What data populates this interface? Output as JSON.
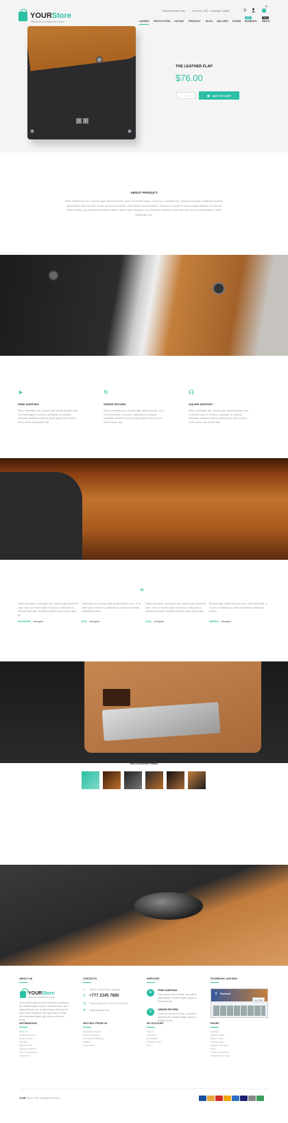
{
  "header": {
    "logo_main": "YOUR",
    "logo_accent": "Store",
    "logo_tagline": "PREMIUM ECOMMERCE THEME",
    "welcome": "Default welcome msg",
    "currency": "Currency: USD",
    "language": "Language: English",
    "cart_count": "0",
    "nav": [
      "LAYOUT",
      "PROTOTYPES",
      "LISTING",
      "PRODUCT",
      "BLOG",
      "GALLERY",
      "PAGES",
      "WOMEN'S",
      "MEN'S"
    ],
    "badges": {
      "womens": "NEW",
      "mens": "SALE"
    }
  },
  "product": {
    "title": "THE LEATHER FLAP",
    "price": "$76.00",
    "qty": "1",
    "minus": "–",
    "plus": "+",
    "add_to_cart": "ADD TO CART",
    "prev": "‹",
    "next": "›"
  },
  "about": {
    "title": "ABOUT PRODUCT",
    "text": "Tellus, scelerisque nec, rhoncus eget, laoreet sit amet, nunc. Ut sit amet turpis. In est arcu, sollicitudin eu, vehicula venenatis, vestibulum pretium, ipsum ipsum dolor sit amet. Donec rutrum arcu laoreet, velit tincidunt euismod libero. Tincidunt ut laoreet et dolore magna aliquam. Ut enim ad minim veniam, quis nostrud exercitation ullamco laboris nisi ut aliquip ex ea commodo consequat. Duis aute irure dolor in reprehenderit. Tellus, scelerisque nec."
  },
  "features": [
    {
      "icon": "➤",
      "title": "FREE SHIPPING",
      "text": "Tellus, scelerisque nec, rhoncus eget, laoreet sit amet, nunc. Ut sit amet turpis. In est arcu, sollicitudin eu, vehicula venenatis, vestibulum pretium, ipsum ipsum dolor sit amet. Donec rutrum arcu laoreet velit."
    },
    {
      "icon": "↻",
      "title": "ORDER RETURN",
      "text": "Tellus, scelerisque nec, rhoncus eget, laoreet sit amet, nunc. Ut sit amet turpis. In est arcu, sollicitudin eu, vehicula venenatis, vestibulum pretium, ipsum ipsum dolor sit amet. Donec rutrum arcu."
    },
    {
      "icon": "☊",
      "title": "ONLINE SUPPORT",
      "text": "Tellus, scelerisque nec, rhoncus eget, laoreet sit amet, nunc. Ut sit amet turpis. In est arcu, sollicitudin eu, vehicula venenatis, vestibulum pretium, ipsum ipsum dolor sit amet. Donec rutrum arcu laoreet velit."
    }
  ],
  "testimonials": {
    "quote": "“",
    "items": [
      {
        "text": "Ornare arcu tellus, scelerisque nec, rhoncus eget, laoreet sit amet, nunc. Ut sit amet turpis. In est arcu, sollicitudin eu, vehicula venenatis, vestibulum pretium, ipsum ipsum dolor sit.",
        "name": "ELEANOR",
        "role": "designer"
      },
      {
        "text": "Scelerisque nec, rhoncus eget laoreet sit amet, nunc. Ut sit amet turpis. In est arcu, sollicitudin eu, vehicula venenatis, vestibulum pretium.",
        "name": "EVA",
        "role": "designer"
      },
      {
        "text": "Ornare arcu tellus, scelerisque nec, rhoncus eget, laoreet sit amet, nunc. Ut sit amet turpis. In est arcu, sollicitudin eu, vehicula venenatis, vestibulum pretium, ipsum ipsum dolor.",
        "name": "LISA",
        "role": "designer"
      },
      {
        "text": "Rhoncus eget, laoreet sit amet, nunc. Ut sit amet turpis. In est arcu, sollicitudin eu, vehicula venenatis, vestibulum pretium.",
        "name": "SARAH",
        "role": "designer"
      }
    ]
  },
  "instagram": {
    "title": "INSTAGRAM FEED"
  },
  "footer": {
    "about": {
      "title": "ABOUT US",
      "logo_main": "YOUR",
      "logo_accent": "Store",
      "logo_tagline": "PREMIUM ECOMMERCE THEME",
      "text": "Lorem ipsum dolor sit amet, consectetur adipiscing elit. Nullam fringilla, augue ut tincidunt luctus, arcu massa tincidunt nisi, ut pellentesque velit augue id dolor. Morbi vestibulum, sem quis semper mattis, velit nulla blandit ligula, eget tempus nisi nisl at lectus."
    },
    "contacts": {
      "title": "CONTACTS",
      "address": "7563 St. Vicent Place, Glasgow",
      "phone": "+777 2345 7885",
      "hours": "7 days a week from 7:00 am to 6:00 pm",
      "email": "info@mydomain.com"
    },
    "services": {
      "title": "SERVICES",
      "items": [
        {
          "title": "FREE SHIPPING",
          "text": "Lorem ipsum dolor sit amet, consectetur adipiscing elit. Nullam fringilla, augue ut tincidunt luctus."
        },
        {
          "title": "ORDER RETURN",
          "text": "Lorem ipsum dolor sit amet, consectetur adipiscing elit. Nullam fringilla, augue ut tincidunt luctus."
        }
      ]
    },
    "facebook": {
      "title": "FACEBOOK LIKE BOX",
      "page": "Facebook",
      "like": "Like Page"
    },
    "information": {
      "title": "INFORMATION",
      "items": [
        "About Us",
        "Customer Service",
        "Privacy Policy",
        "Site Map",
        "Search Terms",
        "Advanced Search",
        "Orders and Returns",
        "Contact Us"
      ]
    },
    "why": {
      "title": "WHY BUY FROM US",
      "items": [
        "Shipping & Returns",
        "Secure Shopping",
        "International Shipping",
        "Affiliates",
        "Group Sales"
      ]
    },
    "account": {
      "title": "MY ACCOUNT",
      "items": [
        "Sign In",
        "View Cart",
        "My Wishlist",
        "Track My Order",
        "Help"
      ]
    },
    "pages": {
      "title": "PAGES",
      "items": [
        "Services",
        "Warranty Page",
        "Select a Type",
        "Payment page",
        "Support 24/7 page",
        "FAQs",
        "Under Construction",
        "Newsletter Sm page"
      ]
    },
    "copyright_brand": "YOUR",
    "copyright": "Store © 2015. All Rights Reserved."
  },
  "colors": {
    "accent": "#2bbfa4",
    "leather": "#b56c28",
    "felt": "#2b2b2d"
  }
}
